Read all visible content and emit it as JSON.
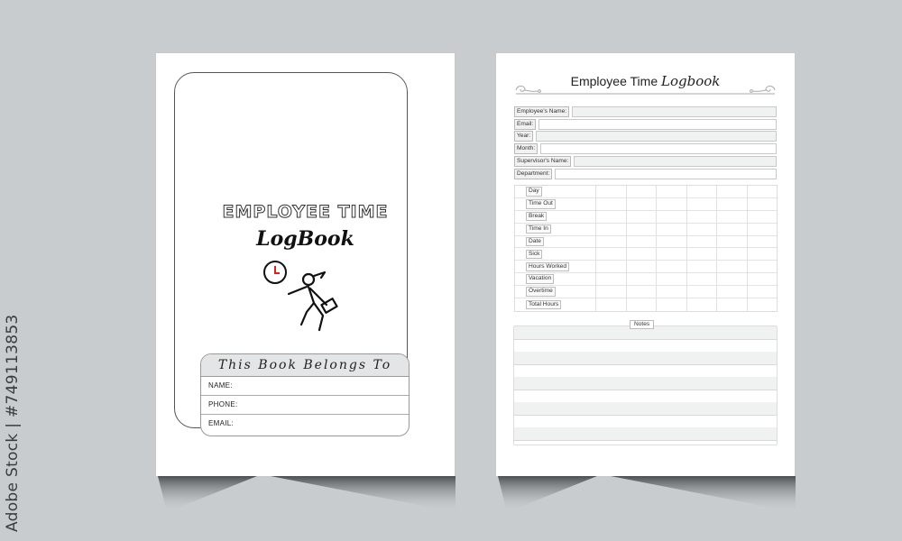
{
  "watermark": {
    "credit": "Adobe Stock | #749113853"
  },
  "cover_page": {
    "title_line1": "EMPLOYEE TIME",
    "title_line2": "LogBook",
    "illustration": "running-employee-with-clock-icon",
    "clock_hand_color": "#e02020",
    "owner_box": {
      "heading": "This Book Belongs To",
      "fields": [
        {
          "label": "NAME:",
          "value": ""
        },
        {
          "label": "PHONE:",
          "value": ""
        },
        {
          "label": "EMAIL:",
          "value": ""
        }
      ]
    }
  },
  "log_page": {
    "title_plain": "Employee Time",
    "title_script": "Logbook",
    "info_fields": [
      {
        "label": "Employee's Name:",
        "value": ""
      },
      {
        "label": "Email:",
        "value": ""
      },
      {
        "label": "Year:",
        "value": ""
      },
      {
        "label": "Month:",
        "value": ""
      },
      {
        "label": "Supervisor's Name:",
        "value": ""
      },
      {
        "label": "Department:",
        "value": ""
      }
    ],
    "timesheet": {
      "rows": [
        "Day",
        "Time Out",
        "Break",
        "Time In",
        "Date",
        "Sick",
        "Hours Worked",
        "Vacation",
        "Overtime",
        "Total Hours"
      ],
      "column_count": 6
    },
    "notes": {
      "label": "Notes",
      "line_count": 5
    }
  },
  "colors": {
    "background": "#c8cccf",
    "page": "#ffffff",
    "field_fill": "#f0f1f1"
  }
}
